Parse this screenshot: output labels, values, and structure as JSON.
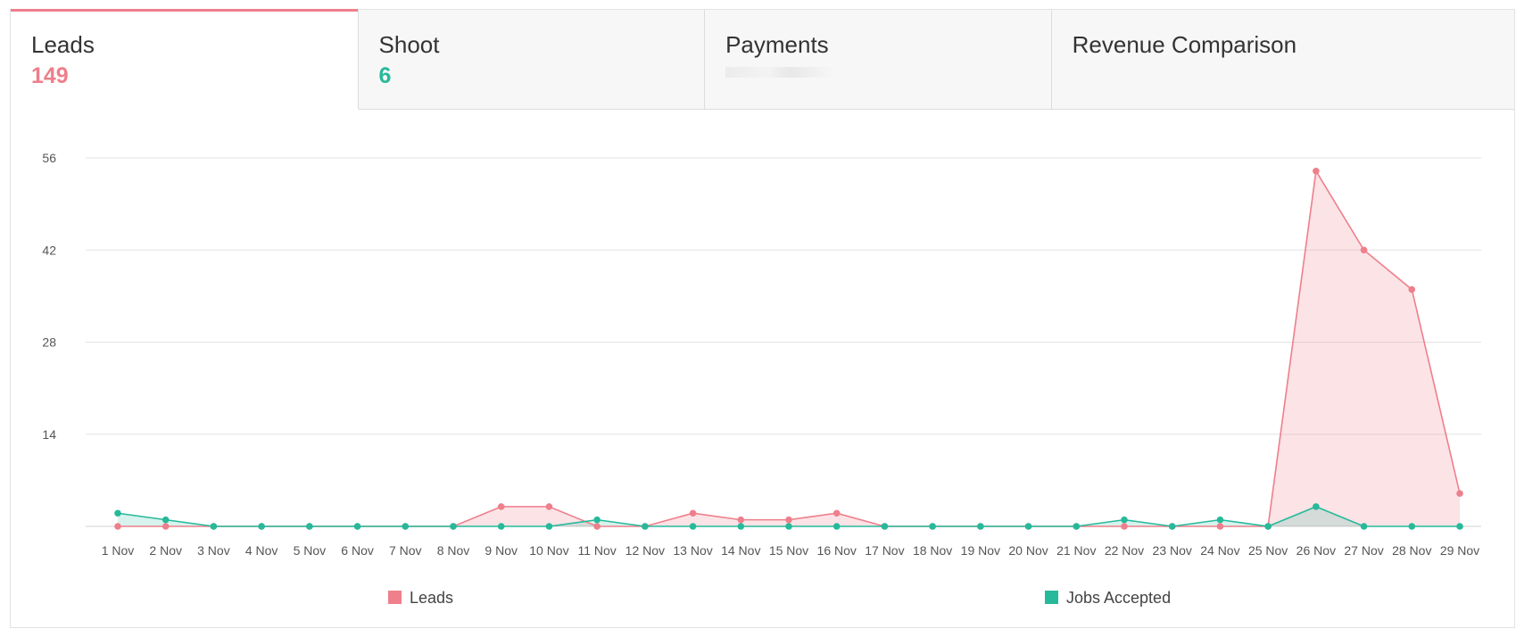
{
  "tabs": [
    {
      "title": "Leads",
      "value": "149",
      "color": "#ee7f8b",
      "active": true
    },
    {
      "title": "Shoot",
      "value": "6",
      "color": "#26b99a",
      "active": false
    },
    {
      "title": "Payments",
      "value": "",
      "color": "#999999",
      "active": false
    },
    {
      "title": "Revenue Comparison",
      "value": "",
      "color": "#999999",
      "active": false
    }
  ],
  "chart_data": {
    "type": "area",
    "categories": [
      "1 Nov",
      "2 Nov",
      "3 Nov",
      "4 Nov",
      "5 Nov",
      "6 Nov",
      "7 Nov",
      "8 Nov",
      "9 Nov",
      "10 Nov",
      "11 Nov",
      "12 Nov",
      "13 Nov",
      "14 Nov",
      "15 Nov",
      "16 Nov",
      "17 Nov",
      "18 Nov",
      "19 Nov",
      "20 Nov",
      "21 Nov",
      "22 Nov",
      "23 Nov",
      "24 Nov",
      "25 Nov",
      "26 Nov",
      "27 Nov",
      "28 Nov",
      "29 Nov"
    ],
    "yticks": [
      14,
      28,
      42,
      56
    ],
    "ylim": [
      0,
      56
    ],
    "series": [
      {
        "name": "Leads",
        "color": "#ee7f8b",
        "values": [
          0,
          0,
          0,
          0,
          0,
          0,
          0,
          0,
          3,
          3,
          0,
          0,
          2,
          1,
          1,
          2,
          0,
          0,
          0,
          0,
          0,
          0,
          0,
          0,
          0,
          54,
          42,
          36,
          5
        ]
      },
      {
        "name": "Jobs Accepted",
        "color": "#26b99a",
        "values": [
          2,
          1,
          0,
          0,
          0,
          0,
          0,
          0,
          0,
          0,
          1,
          0,
          0,
          0,
          0,
          0,
          0,
          0,
          0,
          0,
          0,
          1,
          0,
          1,
          0,
          3,
          0,
          0,
          0
        ]
      }
    ],
    "grid": true,
    "legend_position": "bottom"
  }
}
